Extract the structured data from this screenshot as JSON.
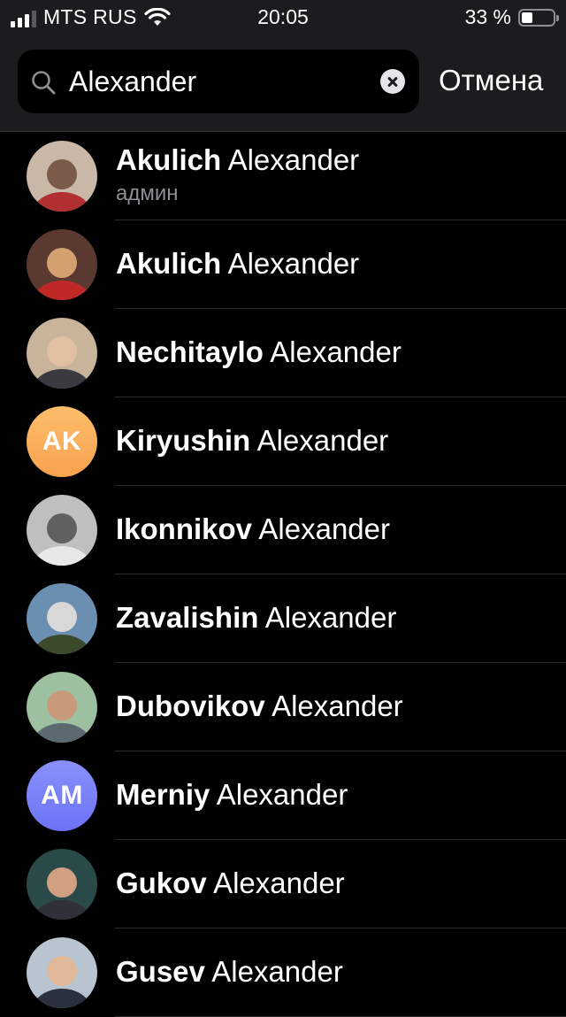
{
  "status_bar": {
    "carrier": "MTS RUS",
    "time": "20:05",
    "battery_percent": "33 %",
    "battery_level": 0.33,
    "signal_bars": 3
  },
  "search": {
    "value": "Alexander",
    "cancel_label": "Отмена"
  },
  "contacts": [
    {
      "last": "Akulich",
      "first": "Alexander",
      "subtitle": "админ",
      "avatar": "photo-icon",
      "initials": ""
    },
    {
      "last": "Akulich",
      "first": "Alexander",
      "subtitle": "",
      "avatar": "photo-icon",
      "initials": ""
    },
    {
      "last": "Nechitaylo",
      "first": "Alexander",
      "subtitle": "",
      "avatar": "photo-icon",
      "initials": ""
    },
    {
      "last": "Kiryushin",
      "first": "Alexander",
      "subtitle": "",
      "avatar": "initials",
      "initials": "AK"
    },
    {
      "last": "Ikonnikov",
      "first": "Alexander",
      "subtitle": "",
      "avatar": "photo-icon",
      "initials": ""
    },
    {
      "last": "Zavalishin",
      "first": "Alexander",
      "subtitle": "",
      "avatar": "photo-icon",
      "initials": ""
    },
    {
      "last": "Dubovikov",
      "first": "Alexander",
      "subtitle": "",
      "avatar": "photo-icon",
      "initials": ""
    },
    {
      "last": "Merniy",
      "first": "Alexander",
      "subtitle": "",
      "avatar": "initials",
      "initials": "AM"
    },
    {
      "last": "Gukov",
      "first": "Alexander",
      "subtitle": "",
      "avatar": "photo-icon",
      "initials": ""
    },
    {
      "last": "Gusev",
      "first": "Alexander",
      "subtitle": "",
      "avatar": "photo-icon",
      "initials": ""
    }
  ],
  "colors": {
    "background": "#000000",
    "bar": "#1c1c1e",
    "secondary_text": "#8e8e93",
    "divider": "#2c2c2e",
    "avatar_orange": "#f7a24f",
    "avatar_blue": "#6b73f5"
  }
}
